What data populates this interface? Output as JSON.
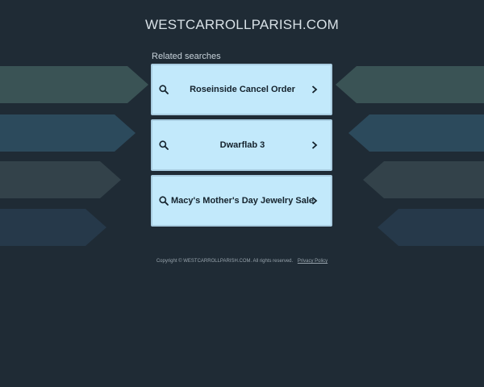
{
  "site": {
    "title": "WESTCARROLLPARISH.COM"
  },
  "related": {
    "heading": "Related searches",
    "items": [
      {
        "label": "Roseinside Cancel Order",
        "icon": "search-icon",
        "arrow": "chevron-right-icon"
      },
      {
        "label": "Dwarflab 3",
        "icon": "search-icon",
        "arrow": "chevron-right-icon"
      },
      {
        "label": "Macy's Mother's Day Jewelry Sale",
        "icon": "search-icon",
        "arrow": "chevron-right-icon"
      }
    ]
  },
  "footer": {
    "copyright": "Copyright © WESTCARROLLPARISH.COM.  All rights reserved.",
    "privacy_label": "Privacy Policy"
  },
  "colors": {
    "background": "#1f2b35",
    "card": "#c2e9fb",
    "card_border": "#a9cde1",
    "deco_arrows": [
      "#3a5355",
      "#2c4a5c",
      "#33424a",
      "#26394a"
    ]
  }
}
